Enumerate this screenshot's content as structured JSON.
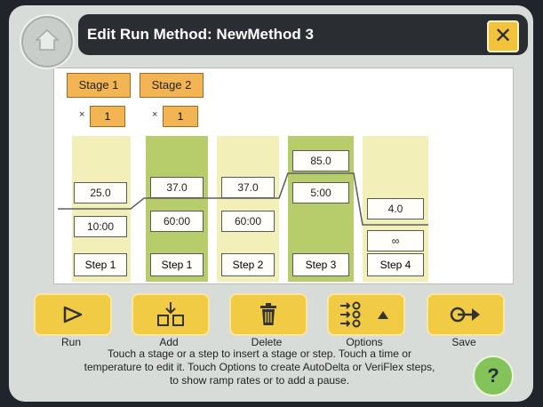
{
  "header": {
    "title": "Edit Run Method: NewMethod 3"
  },
  "stages": [
    {
      "label": "Stage 1",
      "cycles_prefix": "×",
      "cycles": "1"
    },
    {
      "label": "Stage 2",
      "cycles_prefix": "×",
      "cycles": "1"
    }
  ],
  "steps": [
    {
      "temperature": "25.0",
      "time": "10:00",
      "label": "Step 1"
    },
    {
      "temperature": "37.0",
      "time": "60:00",
      "label": "Step 1"
    },
    {
      "temperature": "37.0",
      "time": "60:00",
      "label": "Step 2"
    },
    {
      "temperature": "85.0",
      "time": "5:00",
      "label": "Step 3"
    },
    {
      "temperature": "4.0",
      "time": "∞",
      "label": "Step 4"
    }
  ],
  "toolbar": {
    "run": "Run",
    "add": "Add",
    "delete": "Delete",
    "options": "Options",
    "save": "Save"
  },
  "help_text": "Touch a stage or a step to insert a stage or step. Touch a time or temperature to edit it. Touch Options to create AutoDelta or VeriFlex steps, to show ramp rates or to add a pause.",
  "help_button": "?",
  "colors": {
    "stage_tab": "#f3b554",
    "step_pale": "#f3efb8",
    "step_selected": "#b7cc6b",
    "button": "#f2cb45",
    "help": "#83c35a"
  },
  "icons": {
    "home": "home-icon",
    "close": "close-icon",
    "run": "play-icon",
    "add": "insert-icon",
    "delete": "trash-icon",
    "options": "options-icon",
    "save": "save-arrow-icon"
  }
}
